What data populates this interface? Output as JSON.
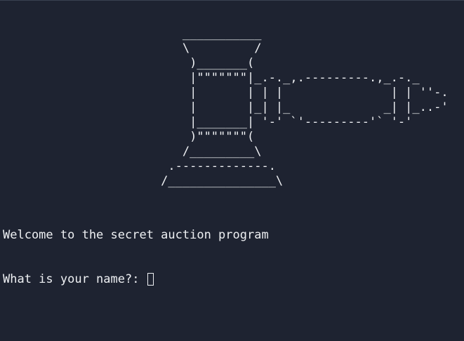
{
  "terminal": {
    "ascii_art": "                         ___________\n                         \\         /\n                          )_______(\n                          |\"\"\"\"\"\"\"|_.-._,.---------.,_.-._\n                          |       | | |               | | ''-.\n                          |       |_| |_             _| |_..-'\n                          |_______| '-' `'---------'` '-'\n                          )\"\"\"\"\"\"\"(\n                         /_________\\\n                       .-------------.\n                      /_______________\\",
    "welcome": "Welcome to the secret auction program",
    "prompt": "What is your name?: "
  }
}
